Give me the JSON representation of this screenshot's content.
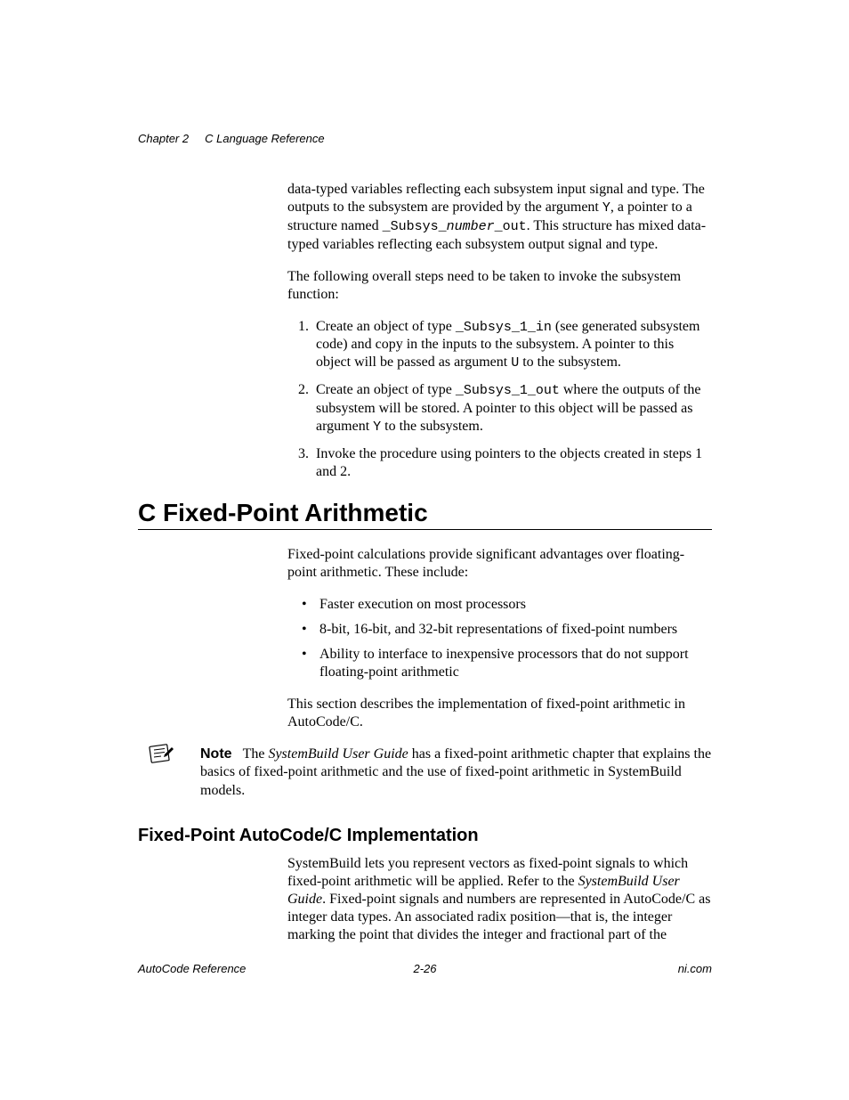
{
  "header": {
    "chapter": "Chapter 2",
    "chapter_title": "C Language Reference"
  },
  "para1_a": "data-typed variables reflecting each subsystem input signal and type. The outputs to the subsystem are provided by the argument ",
  "para1_code1": "Y",
  "para1_b": ", a pointer to a structure named ",
  "para1_code2": "_Subsys_",
  "para1_code2i": "number",
  "para1_code2b": "_out",
  "para1_c": ". This structure has mixed data-typed variables reflecting each subsystem output signal and type.",
  "para2": "The following overall steps need to be taken to invoke the subsystem function:",
  "steps": {
    "s1a": "Create an object of type ",
    "s1code": "_Subsys_1_in",
    "s1b": " (see generated subsystem code) and copy in the inputs to the subsystem. A pointer to this object will be passed as argument ",
    "s1code2": "U",
    "s1c": " to the subsystem.",
    "s2a": "Create an object of type ",
    "s2code": "_Subsys_1_out",
    "s2b": " where the outputs of the subsystem will be stored. A pointer to this object will be passed as argument ",
    "s2code2": "Y",
    "s2c": " to the subsystem.",
    "s3": "Invoke the procedure using pointers to the objects created in steps 1 and 2."
  },
  "h1": "C Fixed-Point Arithmetic",
  "fp_intro": "Fixed-point calculations provide significant advantages over floating-point arithmetic. These include:",
  "bullets": {
    "b1": "Faster execution on most processors",
    "b2": "8-bit, 16-bit, and 32-bit representations of fixed-point numbers",
    "b3": "Ability to interface to inexpensive processors that do not support floating-point arithmetic"
  },
  "fp_desc": "This section describes the implementation of fixed-point arithmetic in AutoCode/C.",
  "note": {
    "label": "Note",
    "a": "The ",
    "i": "SystemBuild User Guide",
    "b": " has a fixed-point arithmetic chapter that explains the basics of fixed-point arithmetic and the use of fixed-point arithmetic in SystemBuild models."
  },
  "h2": "Fixed-Point AutoCode/C Implementation",
  "impl_a": "SystemBuild lets you represent vectors as fixed-point signals to which fixed-point arithmetic will be applied. Refer to the ",
  "impl_i": "SystemBuild User Guide",
  "impl_b": ". Fixed-point signals and numbers are represented in AutoCode/C as integer data types. An associated radix position—that is, the integer marking the point that divides the integer and fractional part of the",
  "footer": {
    "left": "AutoCode Reference",
    "center": "2-26",
    "right": "ni.com"
  }
}
